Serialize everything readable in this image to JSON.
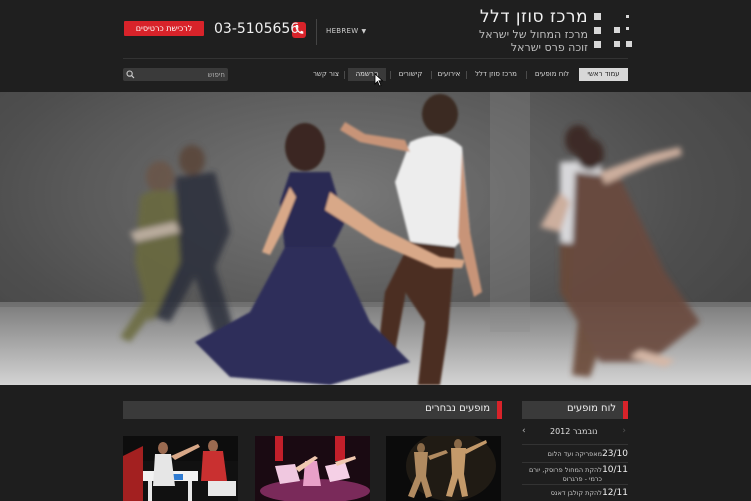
{
  "header": {
    "logo_title": "מרכז סוזן דלל",
    "logo_sub1": "מרכז המחול של ישראל",
    "logo_sub2": "זוכה פרס ישראל",
    "language": "HEBREW",
    "phone": "03-5105656",
    "ticket_button": "לרכישת כרטיסים"
  },
  "nav": {
    "items": [
      {
        "label": "עמוד ראשי",
        "state": "active"
      },
      {
        "label": "לוח מופעים",
        "state": "normal"
      },
      {
        "label": "מרכז סוזן דלל",
        "state": "normal"
      },
      {
        "label": "אירועים",
        "state": "normal"
      },
      {
        "label": "קישורים",
        "state": "normal"
      },
      {
        "label": "הרשמה",
        "state": "hover"
      },
      {
        "label": "צור קשר",
        "state": "normal"
      }
    ],
    "search_placeholder": "חיפוש"
  },
  "featured": {
    "title": "מופעים נבחרים"
  },
  "schedule": {
    "title": "לוח מופעים",
    "month": "נובמבר 2012",
    "events": [
      {
        "date": "23/10",
        "name": "מאפריקה ועד הלום"
      },
      {
        "date": "10/11",
        "name": "להקת המחול פרוסק, יורם כרמי - פרגרוס"
      },
      {
        "date": "12/11",
        "name": "להקת קולבן דאנס"
      }
    ]
  },
  "colors": {
    "accent": "#d8232a",
    "background": "#1e1e1e",
    "section_header": "#3a3a3a"
  },
  "icons": {
    "phone": "phone-icon",
    "search": "search-icon",
    "logo": "grid-squares-logo"
  }
}
